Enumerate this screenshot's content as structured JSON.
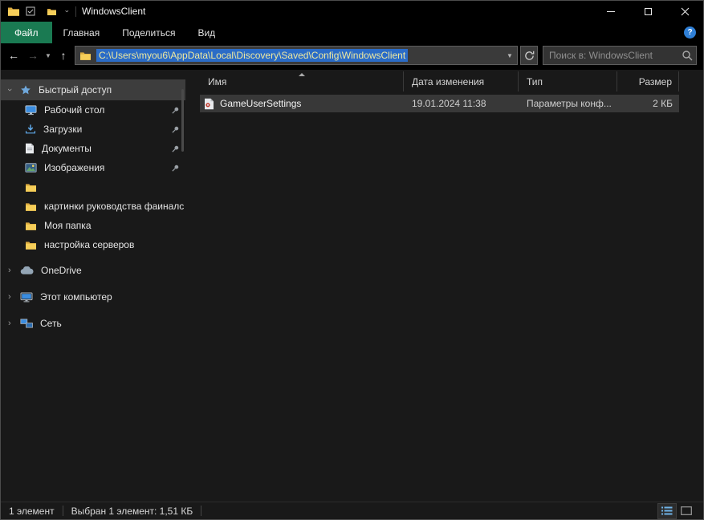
{
  "window": {
    "title": "WindowsClient"
  },
  "ribbon": {
    "tabs": [
      {
        "label": "Файл",
        "active": true
      },
      {
        "label": "Главная",
        "active": false
      },
      {
        "label": "Поделиться",
        "active": false
      },
      {
        "label": "Вид",
        "active": false
      }
    ],
    "help_label": "?"
  },
  "addressbar": {
    "path": "C:\\Users\\myou6\\AppData\\Local\\Discovery\\Saved\\Config\\WindowsClient",
    "search_placeholder": "Поиск в: WindowsClient"
  },
  "sidebar": {
    "items": [
      {
        "label": "Быстрый доступ",
        "icon": "star-icon",
        "selected": true,
        "expanded": true
      },
      {
        "label": "Рабочий стол",
        "icon": "desktop-icon",
        "pinned": true
      },
      {
        "label": "Загрузки",
        "icon": "downloads-icon",
        "pinned": true
      },
      {
        "label": "Документы",
        "icon": "documents-icon",
        "pinned": true
      },
      {
        "label": "Изображения",
        "icon": "pictures-icon",
        "pinned": true
      },
      {
        "label": "",
        "icon": "folder-icon",
        "pinned": false
      },
      {
        "label": "картинки руководства фаиналс",
        "icon": "folder-icon",
        "pinned": false
      },
      {
        "label": "Моя папка",
        "icon": "folder-icon",
        "pinned": false
      },
      {
        "label": "настройка серверов",
        "icon": "folder-icon",
        "pinned": false
      },
      {
        "label": "OneDrive",
        "icon": "onedrive-icon",
        "group": true
      },
      {
        "label": "Этот компьютер",
        "icon": "computer-icon",
        "group": true
      },
      {
        "label": "Сеть",
        "icon": "network-icon",
        "group": true
      }
    ]
  },
  "filelist": {
    "columns": [
      {
        "label": "Имя",
        "sorted": "asc"
      },
      {
        "label": "Дата изменения"
      },
      {
        "label": "Тип"
      },
      {
        "label": "Размер"
      }
    ],
    "rows": [
      {
        "name": "GameUserSettings",
        "date": "19.01.2024 11:38",
        "type": "Параметры конф...",
        "size": "2 КБ",
        "selected": true,
        "icon": "config-file-icon"
      }
    ]
  },
  "statusbar": {
    "count": "1 элемент",
    "selection": "Выбран 1 элемент: 1,51 КБ"
  },
  "colors": {
    "file_tab_bg": "#1a7a52",
    "address_selection_bg": "#2b6cc7",
    "address_selection_fg": "#efe9a0",
    "help_badge_bg": "#2f7fd6",
    "sidebar_selected_bg": "#3d3d3d",
    "row_selected_bg": "#383838",
    "folder_icon_color": "#f6ce59"
  }
}
